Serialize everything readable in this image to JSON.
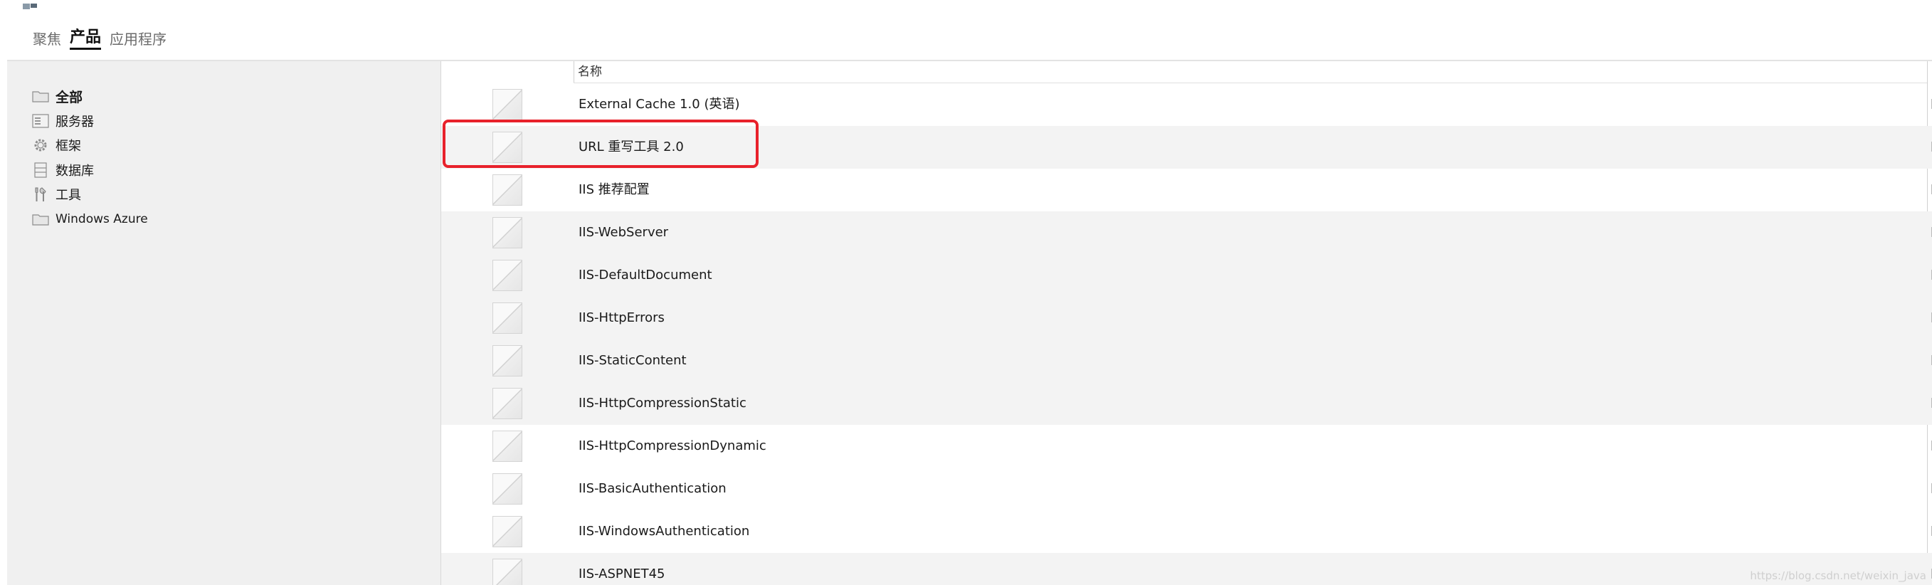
{
  "nav": {
    "tabs": [
      {
        "label": "聚焦",
        "active": false
      },
      {
        "label": "产品",
        "active": true
      },
      {
        "label": "应用程序",
        "active": false
      }
    ]
  },
  "sidebar": {
    "items": [
      {
        "label": "全部",
        "icon": "folder-icon"
      },
      {
        "label": "服务器",
        "icon": "server-icon"
      },
      {
        "label": "框架",
        "icon": "gear-icon"
      },
      {
        "label": "数据库",
        "icon": "database-icon"
      },
      {
        "label": "工具",
        "icon": "tools-icon"
      },
      {
        "label": "Windows Azure",
        "icon": "folder-icon"
      }
    ]
  },
  "list": {
    "column_header": "名称",
    "rows": [
      "External Cache 1.0 (英语)",
      "URL 重写工具 2.0",
      "IIS 推荐配置",
      "IIS-WebServer",
      "IIS-DefaultDocument",
      "IIS-HttpErrors",
      "IIS-StaticContent",
      "IIS-HttpCompressionStatic",
      "IIS-HttpCompressionDynamic",
      "IIS-BasicAuthentication",
      "IIS-WindowsAuthentication",
      "IIS-ASPNET45"
    ]
  },
  "colors": {
    "highlight": "#e8212b",
    "sidebar_bg": "#f0f0f0",
    "row_alt_bg": "#f3f3f3"
  },
  "watermark": "https://blog.csdn.net/weixin_java"
}
